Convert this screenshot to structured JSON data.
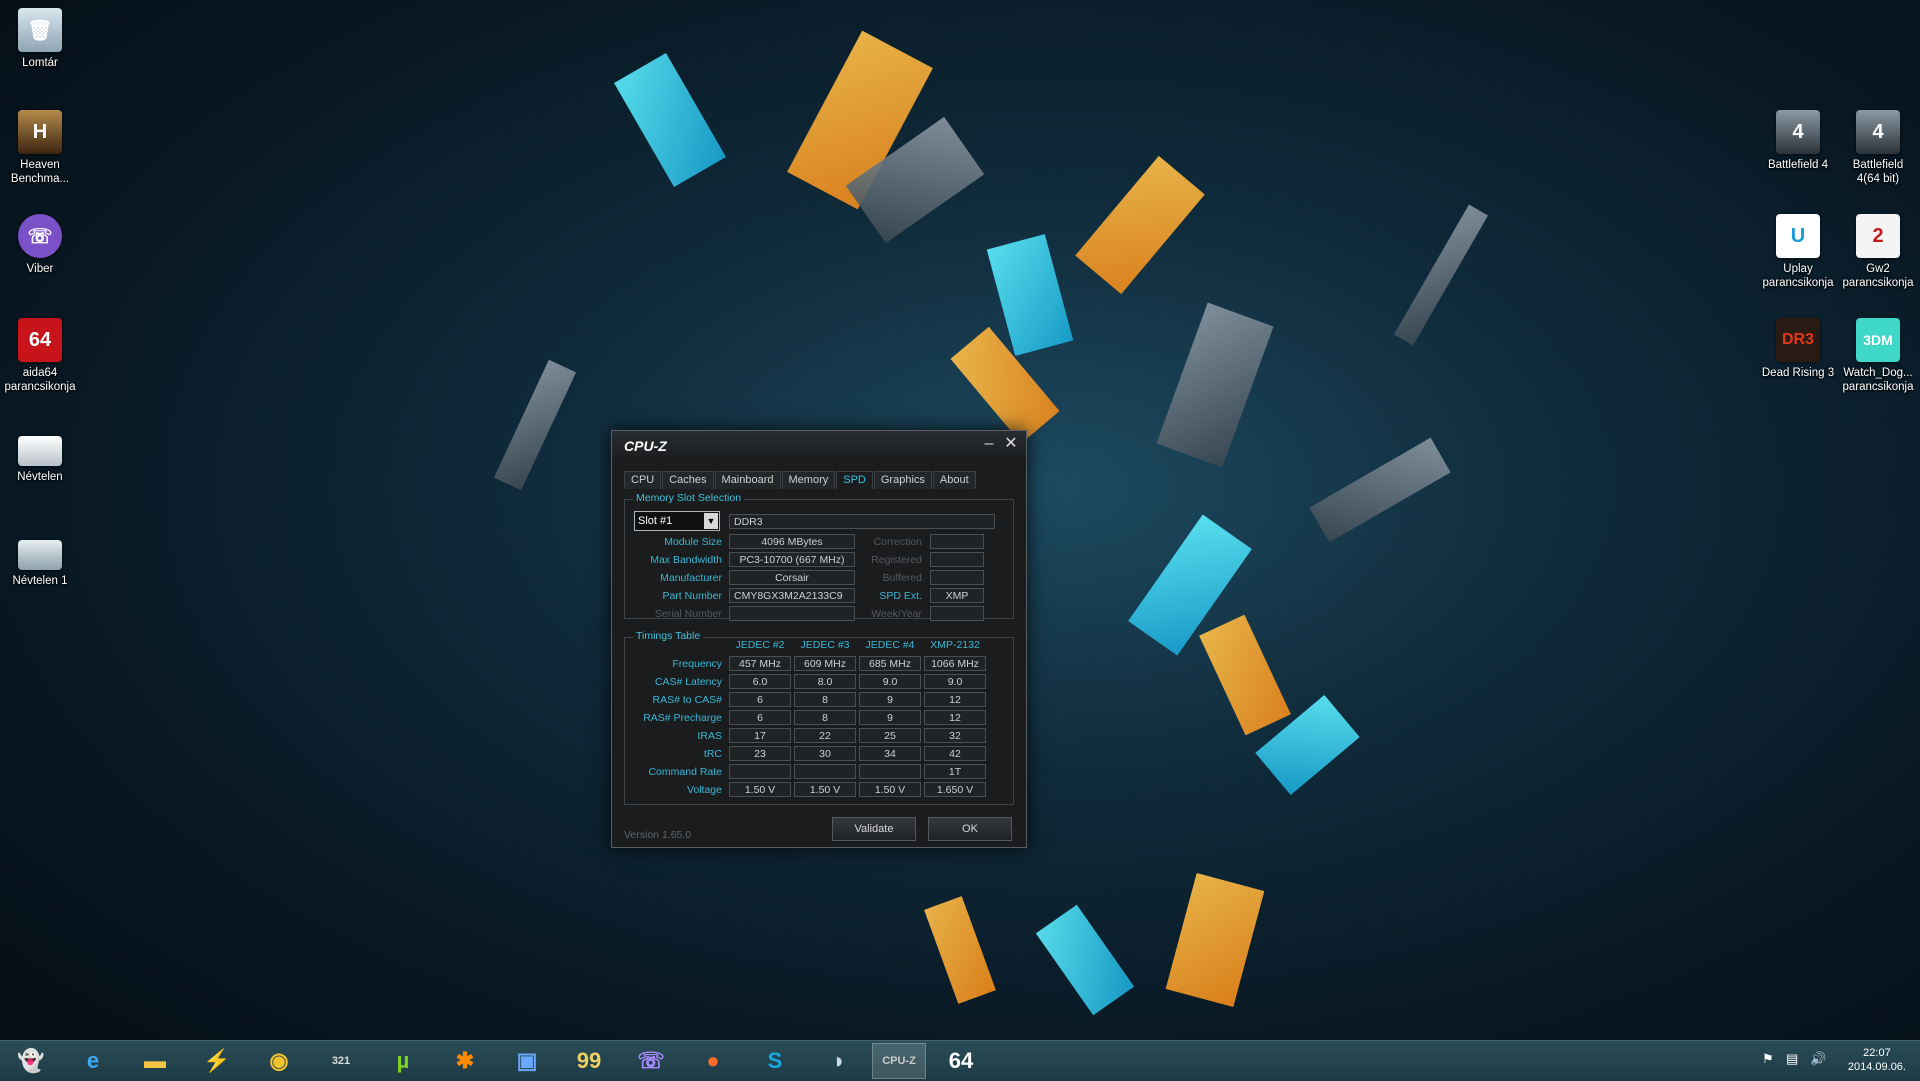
{
  "desktop": {
    "left_icons": [
      {
        "label": "Lomtár",
        "icon": "recycle-bin-icon"
      },
      {
        "label": "Heaven\nBenchma...",
        "icon": "heaven-benchmark-icon"
      },
      {
        "label": "Viber",
        "icon": "viber-icon"
      },
      {
        "label": "aida64\nparancsikonja",
        "icon": "aida64-icon"
      },
      {
        "label": "Névtelen",
        "icon": "folder-icon"
      },
      {
        "label": "Névtelen 1",
        "icon": "folder-icon"
      }
    ],
    "right_icons": [
      {
        "label": "Battlefield 4",
        "icon": "battlefield-icon"
      },
      {
        "label": "Battlefield\n4(64 bit)",
        "icon": "battlefield-icon"
      },
      {
        "label": "Uplay\nparancsikonja",
        "icon": "uplay-icon"
      },
      {
        "label": "Gw2\nparancsikonja",
        "icon": "gw2-icon"
      },
      {
        "label": "Dead Rising 3",
        "icon": "dead-rising-icon"
      },
      {
        "label": "Watch_Dog...\nparancsikonja",
        "icon": "watch-dogs-icon"
      }
    ]
  },
  "cpuz": {
    "title": "CPU-Z",
    "tabs": [
      "CPU",
      "Caches",
      "Mainboard",
      "Memory",
      "SPD",
      "Graphics",
      "About"
    ],
    "active_tab": "SPD",
    "slot_group_title": "Memory Slot Selection",
    "slot_selected": "Slot #1",
    "memory_type": "DDR3",
    "fields": {
      "module_size_label": "Module Size",
      "module_size": "4096 MBytes",
      "max_bandwidth_label": "Max Bandwidth",
      "max_bandwidth": "PC3-10700 (667 MHz)",
      "manufacturer_label": "Manufacturer",
      "manufacturer": "Corsair",
      "part_number_label": "Part Number",
      "part_number": "CMY8GX3M2A2133C9",
      "serial_number_label": "Serial Number",
      "serial_number": "",
      "correction_label": "Correction",
      "correction": "",
      "registered_label": "Registered",
      "registered": "",
      "buffered_label": "Buffered",
      "buffered": "",
      "spd_ext_label": "SPD Ext.",
      "spd_ext": "XMP",
      "week_year_label": "Week/Year",
      "week_year": ""
    },
    "timings_group_title": "Timings Table",
    "timing_columns": [
      "JEDEC #2",
      "JEDEC #3",
      "JEDEC #4",
      "XMP-2132"
    ],
    "timing_rows": [
      {
        "label": "Frequency",
        "values": [
          "457 MHz",
          "609 MHz",
          "685 MHz",
          "1066 MHz"
        ]
      },
      {
        "label": "CAS# Latency",
        "values": [
          "6.0",
          "8.0",
          "9.0",
          "9.0"
        ]
      },
      {
        "label": "RAS# to CAS#",
        "values": [
          "6",
          "8",
          "9",
          "12"
        ]
      },
      {
        "label": "RAS# Precharge",
        "values": [
          "6",
          "8",
          "9",
          "12"
        ]
      },
      {
        "label": "tRAS",
        "values": [
          "17",
          "22",
          "25",
          "32"
        ]
      },
      {
        "label": "tRC",
        "values": [
          "23",
          "30",
          "34",
          "42"
        ]
      },
      {
        "label": "Command Rate",
        "values": [
          "",
          "",
          "",
          "1T"
        ]
      },
      {
        "label": "Voltage",
        "values": [
          "1.50 V",
          "1.50 V",
          "1.50 V",
          "1.650 V"
        ]
      }
    ],
    "validate_label": "Validate",
    "ok_label": "OK",
    "version": "Version 1.65.0",
    "accent_color": "#38b8d6"
  },
  "taskbar": {
    "apps": [
      {
        "glyph": "👻",
        "icon": "start-ghost-icon",
        "color": "#eeeeee"
      },
      {
        "glyph": "e",
        "icon": "internet-explorer-icon",
        "color": "#3fa9f5"
      },
      {
        "glyph": "▬",
        "icon": "file-explorer-icon",
        "color": "#f4c542"
      },
      {
        "glyph": "⚡",
        "icon": "flashget-icon",
        "color": "#ff5a2a"
      },
      {
        "glyph": "◉",
        "icon": "chrome-icon",
        "color": "#f2c12e"
      },
      {
        "glyph": "321",
        "icon": "media-player-icon",
        "color": "#dddddd"
      },
      {
        "glyph": "µ",
        "icon": "utorrent-icon",
        "color": "#7ed321"
      },
      {
        "glyph": "✱",
        "icon": "avast-icon",
        "color": "#ff8a00"
      },
      {
        "glyph": "▣",
        "icon": "save-disk-icon",
        "color": "#6aa8ff"
      },
      {
        "glyph": "99",
        "icon": "notes-icon",
        "color": "#f0d060"
      },
      {
        "glyph": "☏",
        "icon": "viber-icon",
        "color": "#a98bff"
      },
      {
        "glyph": "●",
        "icon": "origin-icon",
        "color": "#ff6a2a"
      },
      {
        "glyph": "S",
        "icon": "skype-icon",
        "color": "#19a9e5"
      },
      {
        "glyph": "◑",
        "icon": "steam-icon",
        "color": "#cfd8dc"
      },
      {
        "glyph": "CPU-Z",
        "icon": "cpuz-icon",
        "color": "#cccccc"
      },
      {
        "glyph": "64",
        "icon": "aida64-icon",
        "color": "#ffffff"
      }
    ],
    "active_app_index": 14,
    "time": "22:07",
    "date": "2014.09.06."
  }
}
